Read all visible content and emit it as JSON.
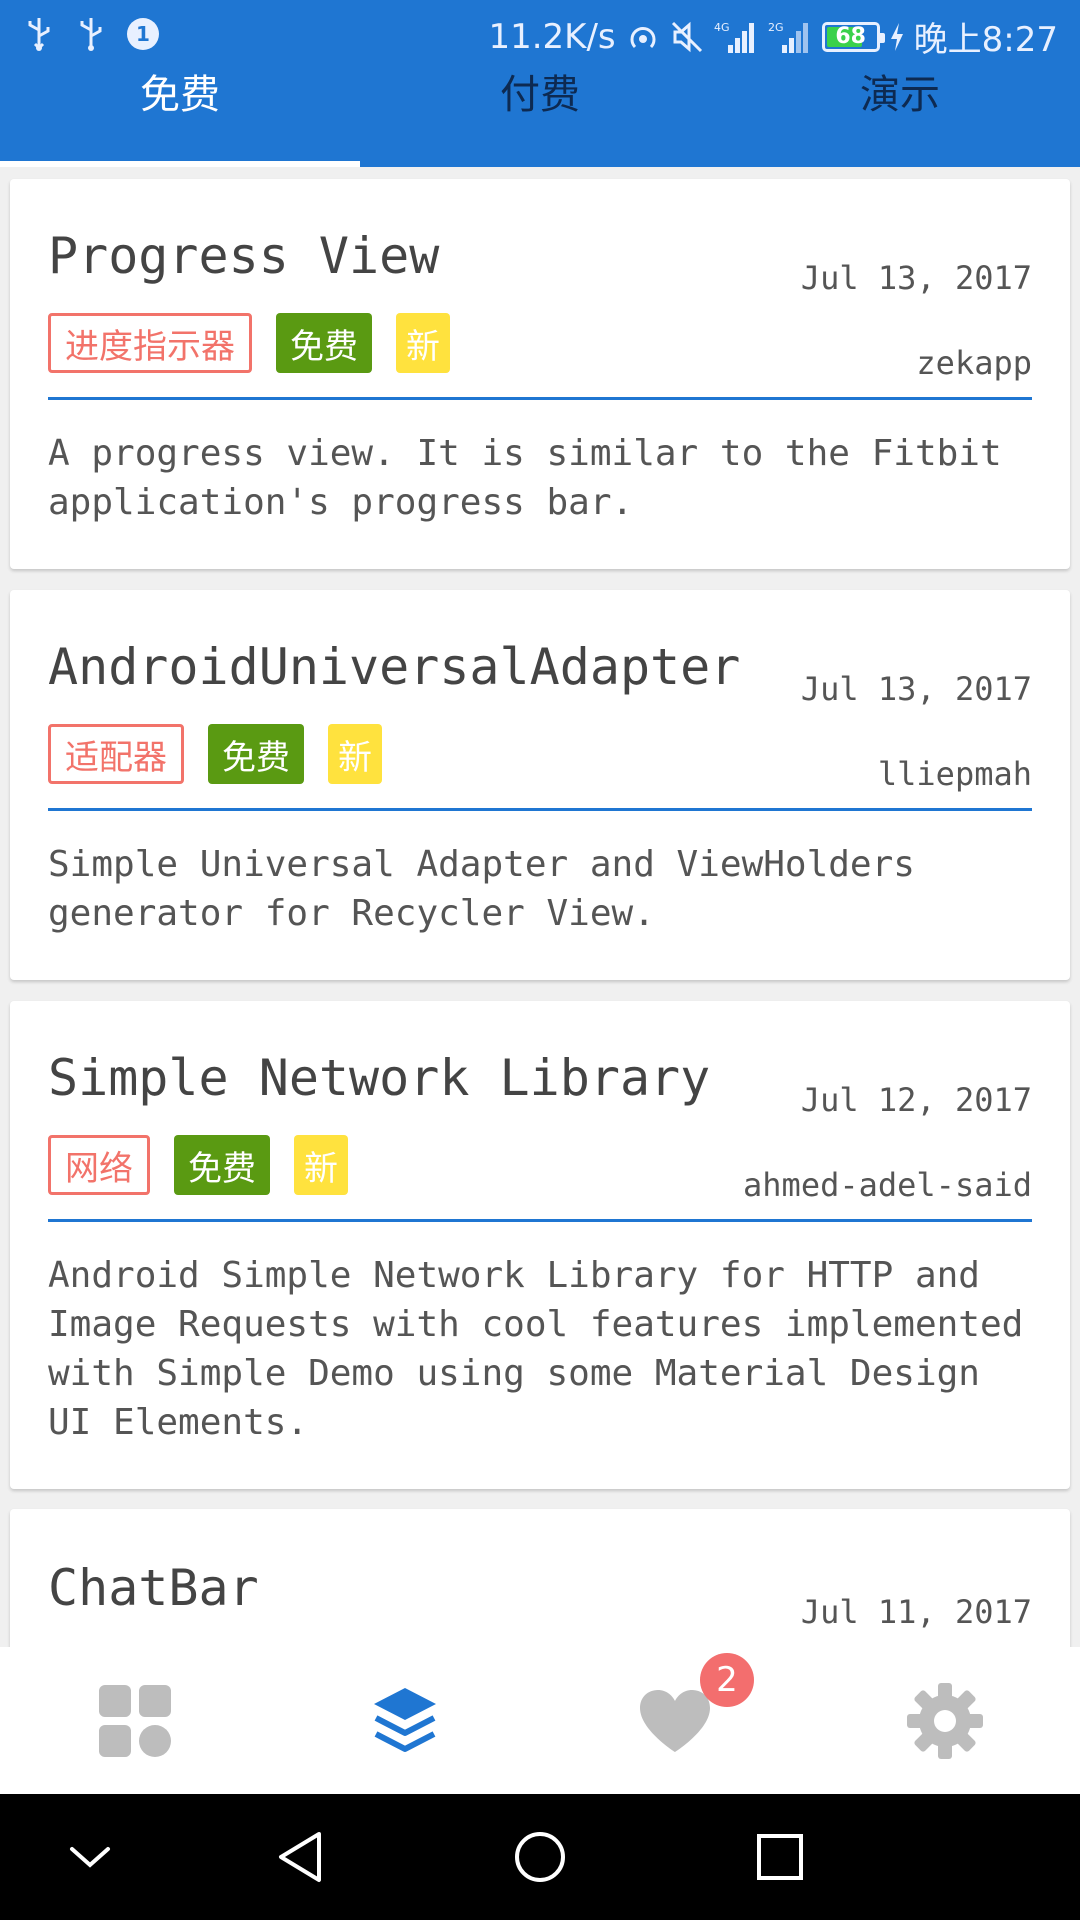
{
  "status_bar": {
    "speed": "11.2K/s",
    "battery_level": "68",
    "time": "晚上8:27",
    "icons": [
      "usb-icon",
      "usb-icon",
      "sim-badge-icon",
      "hotspot-icon",
      "mute-icon",
      "signal-4g-icon",
      "signal-2g-icon",
      "battery-icon",
      "charging-icon"
    ]
  },
  "tabs": [
    {
      "label": "免费",
      "active": true
    },
    {
      "label": "付费",
      "active": false
    },
    {
      "label": "演示",
      "active": false
    }
  ],
  "cards": [
    {
      "title": "Progress View",
      "date": "Jul 13, 2017",
      "author": "zekapp",
      "tags": {
        "category": "进度指示器",
        "price": "免费",
        "new": "新"
      },
      "description": "A progress view. It is similar to the Fitbit application's progress bar."
    },
    {
      "title": "AndroidUniversalAdapter",
      "date": "Jul 13, 2017",
      "author": "lliepmah",
      "tags": {
        "category": "适配器",
        "price": "免费",
        "new": "新"
      },
      "description": "Simple Universal Adapter and ViewHolders generator for Recycler View."
    },
    {
      "title": "Simple Network Library",
      "date": "Jul 12, 2017",
      "author": "ahmed-adel-said",
      "tags": {
        "category": "网络",
        "price": "免费",
        "new": "新"
      },
      "description": "Android Simple Network Library for HTTP and Image Requests with cool features implemented with Simple Demo using some Material Design UI Elements."
    },
    {
      "title": "ChatBar",
      "date": "Jul 11, 2017"
    }
  ],
  "bottom_nav": [
    {
      "icon": "grid-icon",
      "active": false
    },
    {
      "icon": "layers-icon",
      "active": true
    },
    {
      "icon": "heart-icon",
      "active": false,
      "badge": "2"
    },
    {
      "icon": "gear-icon",
      "active": false
    }
  ],
  "colors": {
    "primary": "#1f76d2",
    "category_tag": "#f2736a",
    "free_tag": "#5a9a12",
    "new_tag": "#ffe23e",
    "badge": "#f36e6e",
    "inactive_icon": "#bdbdbd"
  }
}
